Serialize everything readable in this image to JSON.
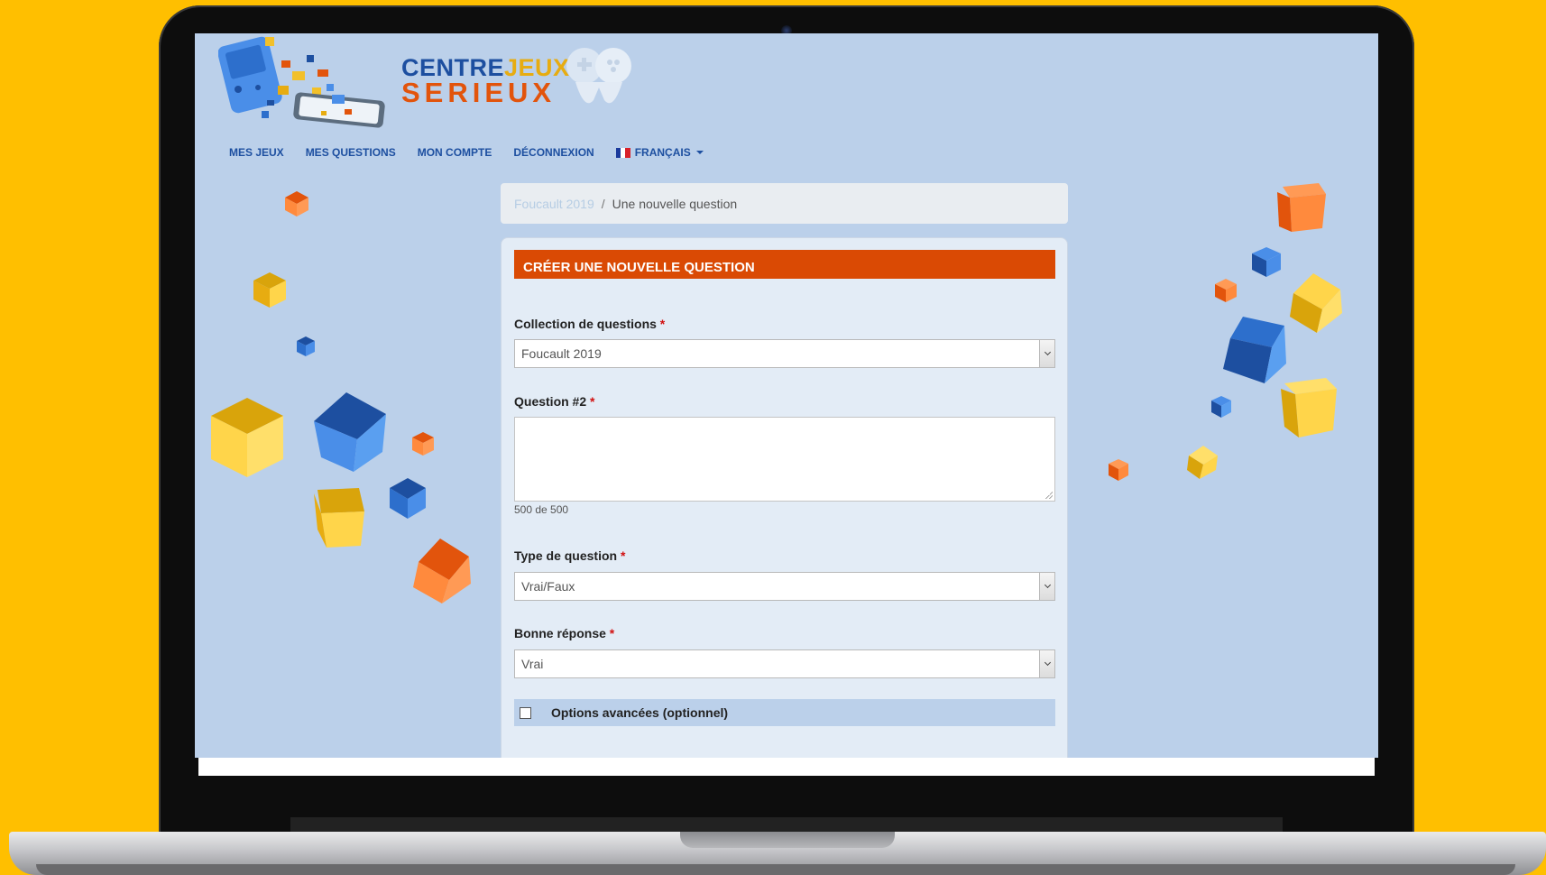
{
  "logo": {
    "line1_part1": "CENTRE",
    "line1_part2": "JEUX",
    "line2": "SERIEUX"
  },
  "nav": {
    "items": [
      {
        "label": "MES JEUX"
      },
      {
        "label": "MES QUESTIONS"
      },
      {
        "label": "MON COMPTE"
      },
      {
        "label": "DÉCONNEXION"
      },
      {
        "label": "FRANÇAIS"
      }
    ]
  },
  "breadcrumb": {
    "parent": "Foucault 2019",
    "separator": "/",
    "current": "Une nouvelle question"
  },
  "form": {
    "title": "CRÉER UNE NOUVELLE QUESTION",
    "required_mark": "*",
    "collection": {
      "label": "Collection de questions",
      "value": "Foucault 2019"
    },
    "question": {
      "label": "Question #2",
      "value": "",
      "counter": "500 de 500"
    },
    "type": {
      "label": "Type de question",
      "value": "Vrai/Faux"
    },
    "answer": {
      "label": "Bonne réponse",
      "value": "Vrai"
    },
    "advanced": {
      "label": "Options avancées (optionnel)",
      "checked": false
    }
  },
  "colors": {
    "background": "#FFBF00",
    "screen": "#BBD0EA",
    "header": "#DA4A04",
    "nav": "#1d4fa0"
  }
}
